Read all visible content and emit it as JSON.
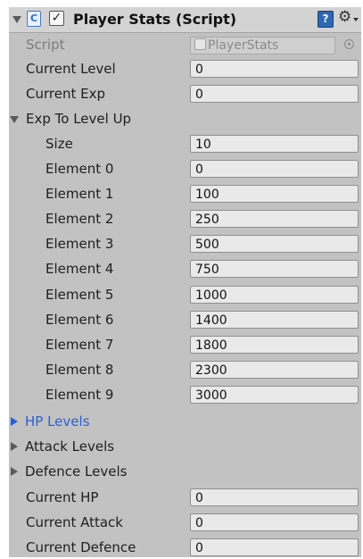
{
  "component": {
    "title": "Player Stats (Script)",
    "script_label": "Script",
    "script_value": "PlayerStats"
  },
  "fields": {
    "current_level": {
      "label": "Current Level",
      "value": "0"
    },
    "current_exp": {
      "label": "Current Exp",
      "value": "0"
    }
  },
  "exp_array": {
    "label": "Exp To Level Up",
    "size_label": "Size",
    "size_value": "10",
    "elements": [
      {
        "label": "Element 0",
        "value": "0"
      },
      {
        "label": "Element 1",
        "value": "100"
      },
      {
        "label": "Element 2",
        "value": "250"
      },
      {
        "label": "Element 3",
        "value": "500"
      },
      {
        "label": "Element 4",
        "value": "750"
      },
      {
        "label": "Element 5",
        "value": "1000"
      },
      {
        "label": "Element 6",
        "value": "1400"
      },
      {
        "label": "Element 7",
        "value": "1800"
      },
      {
        "label": "Element 8",
        "value": "2300"
      },
      {
        "label": "Element 9",
        "value": "3000"
      }
    ]
  },
  "collapsed": {
    "hp_levels": "HP Levels",
    "attack_levels": "Attack Levels",
    "defence_levels": "Defence Levels"
  },
  "stats": {
    "current_hp": {
      "label": "Current HP",
      "value": "0"
    },
    "current_attack": {
      "label": "Current Attack",
      "value": "0"
    },
    "current_defence": {
      "label": "Current Defence",
      "value": "0"
    }
  },
  "colors": {
    "panel_bg": "#c2c2c2",
    "header_bg": "#d3d3d3",
    "selected_foldout": "#2b5ed8"
  },
  "icons": [
    "foldout-arrow-icon",
    "csharp-script-icon",
    "checkbox-icon",
    "help-book-icon",
    "gear-icon",
    "object-picker-icon"
  ]
}
